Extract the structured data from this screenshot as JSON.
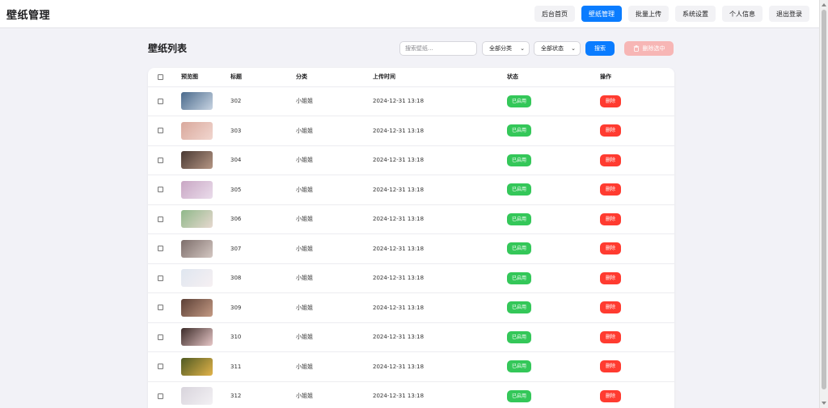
{
  "header": {
    "title": "壁纸管理",
    "nav": [
      {
        "label": "后台首页",
        "active": false
      },
      {
        "label": "壁纸管理",
        "active": true
      },
      {
        "label": "批量上传",
        "active": false
      },
      {
        "label": "系统设置",
        "active": false
      },
      {
        "label": "个人信息",
        "active": false
      },
      {
        "label": "退出登录",
        "active": false
      }
    ]
  },
  "main": {
    "title": "壁纸列表",
    "search_placeholder": "搜索壁纸...",
    "category_select": "全部分类",
    "status_select": "全部状态",
    "search_button": "搜索",
    "bulk_delete_button": "删除选中"
  },
  "table": {
    "columns": [
      "预览图",
      "标题",
      "分类",
      "上传时间",
      "状态",
      "操作"
    ],
    "rows": [
      {
        "title": "302",
        "category": "小姐姐",
        "uploaded": "2024-12-31 13:18",
        "status": "已启用",
        "action": "删除",
        "thumb": [
          "#4a6a8c",
          "#c8d4e2"
        ]
      },
      {
        "title": "303",
        "category": "小姐姐",
        "uploaded": "2024-12-31 13:18",
        "status": "已启用",
        "action": "删除",
        "thumb": [
          "#d9a89c",
          "#f1d6cf"
        ]
      },
      {
        "title": "304",
        "category": "小姐姐",
        "uploaded": "2024-12-31 13:18",
        "status": "已启用",
        "action": "删除",
        "thumb": [
          "#4a3a34",
          "#b59684"
        ]
      },
      {
        "title": "305",
        "category": "小姐姐",
        "uploaded": "2024-12-31 13:18",
        "status": "已启用",
        "action": "删除",
        "thumb": [
          "#c9a7c4",
          "#eadceb"
        ]
      },
      {
        "title": "306",
        "category": "小姐姐",
        "uploaded": "2024-12-31 13:18",
        "status": "已启用",
        "action": "删除",
        "thumb": [
          "#8fb88a",
          "#e7d8cf"
        ]
      },
      {
        "title": "307",
        "category": "小姐姐",
        "uploaded": "2024-12-31 13:18",
        "status": "已启用",
        "action": "删除",
        "thumb": [
          "#7d6e6b",
          "#d4c7c2"
        ]
      },
      {
        "title": "308",
        "category": "小姐姐",
        "uploaded": "2024-12-31 13:18",
        "status": "已启用",
        "action": "删除",
        "thumb": [
          "#dfe6f0",
          "#f6f0f2"
        ]
      },
      {
        "title": "309",
        "category": "小姐姐",
        "uploaded": "2024-12-31 13:18",
        "status": "已启用",
        "action": "删除",
        "thumb": [
          "#5c4036",
          "#c49a84"
        ]
      },
      {
        "title": "310",
        "category": "小姐姐",
        "uploaded": "2024-12-31 13:18",
        "status": "已启用",
        "action": "删除",
        "thumb": [
          "#3d2c2a",
          "#e6c6c6"
        ]
      },
      {
        "title": "311",
        "category": "小姐姐",
        "uploaded": "2024-12-31 13:18",
        "status": "已启用",
        "action": "删除",
        "thumb": [
          "#4f5a22",
          "#e2b34a"
        ]
      },
      {
        "title": "312",
        "category": "小姐姐",
        "uploaded": "2024-12-31 13:18",
        "status": "已启用",
        "action": "删除",
        "thumb": [
          "#d8d4dc",
          "#f3f1f4"
        ]
      }
    ]
  },
  "colors": {
    "accent": "#0a7cff",
    "enabled_badge": "#34c759",
    "delete": "#ff3b30",
    "bulk_delete_disabled": "#f7b6b5"
  },
  "icons": {
    "bulk_delete": "trash-icon",
    "select_chevron": "chevron-down-icon"
  }
}
